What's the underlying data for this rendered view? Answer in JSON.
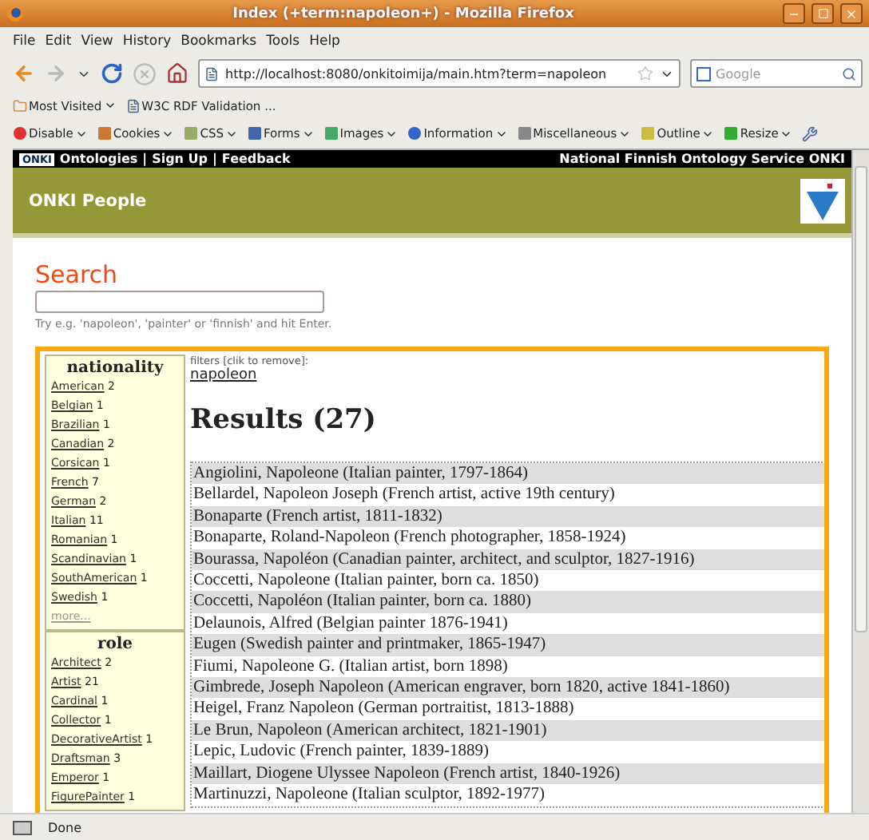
{
  "window": {
    "title": "Index (+term:napoleon+) - Mozilla Firefox"
  },
  "menu": [
    "File",
    "Edit",
    "View",
    "History",
    "Bookmarks",
    "Tools",
    "Help"
  ],
  "nav": {
    "url": "http://localhost:8080/onkitoimija/main.htm?term=napoleon",
    "search_placeholder": "Google"
  },
  "bookmarks": [
    "Most Visited",
    "W3C RDF Validation ..."
  ],
  "dev_toolbar": [
    {
      "label": "Disable",
      "kind": "disable"
    },
    {
      "label": "Cookies",
      "kind": "cookies"
    },
    {
      "label": "CSS",
      "kind": "css"
    },
    {
      "label": "Forms",
      "kind": "forms"
    },
    {
      "label": "Images",
      "kind": "images"
    },
    {
      "label": "Information",
      "kind": "information"
    },
    {
      "label": "Miscellaneous",
      "kind": "misc"
    },
    {
      "label": "Outline",
      "kind": "outline"
    },
    {
      "label": "Resize",
      "kind": "resize"
    }
  ],
  "site_bar": {
    "logo": "ONKI",
    "links": [
      "Ontologies",
      "Sign Up",
      "Feedback"
    ],
    "separator": "|",
    "service": "National Finnish Ontology Service ONKI"
  },
  "header": {
    "title": "ONKI People"
  },
  "search": {
    "heading": "Search",
    "hint": "Try e.g. 'napoleon', 'painter' or 'finnish' and hit Enter."
  },
  "facets": [
    {
      "title": "nationality",
      "more": "more...",
      "items": [
        {
          "label": "American",
          "count": "2"
        },
        {
          "label": "Belgian",
          "count": "1"
        },
        {
          "label": "Brazilian",
          "count": "1"
        },
        {
          "label": "Canadian",
          "count": "2"
        },
        {
          "label": "Corsican",
          "count": "1"
        },
        {
          "label": "French",
          "count": "7"
        },
        {
          "label": "German",
          "count": "2"
        },
        {
          "label": "Italian",
          "count": "11"
        },
        {
          "label": "Romanian",
          "count": "1"
        },
        {
          "label": "Scandinavian",
          "count": "1"
        },
        {
          "label": "SouthAmerican",
          "count": "1"
        },
        {
          "label": "Swedish",
          "count": "1"
        }
      ]
    },
    {
      "title": "role",
      "items": [
        {
          "label": "Architect",
          "count": "2"
        },
        {
          "label": "Artist",
          "count": "21"
        },
        {
          "label": "Cardinal",
          "count": "1"
        },
        {
          "label": "Collector",
          "count": "1"
        },
        {
          "label": "DecorativeArtist",
          "count": "1"
        },
        {
          "label": "Draftsman",
          "count": "3"
        },
        {
          "label": "Emperor",
          "count": "1"
        },
        {
          "label": "FigurePainter",
          "count": "1"
        }
      ]
    }
  ],
  "filters": {
    "label": "filters [clik to remove]:",
    "items": [
      "napoleon"
    ]
  },
  "results": {
    "heading": "Results (27)",
    "rows": [
      "Angiolini, Napoleone (Italian painter, 1797-1864)",
      "Bellardel, Napoleon Joseph (French artist, active 19th century)",
      "Bonaparte (French artist, 1811-1832)",
      "Bonaparte, Roland-Napoleon (French photographer, 1858-1924)",
      "Bourassa, Napoléon (Canadian painter, architect, and sculptor, 1827-1916)",
      "Coccetti, Napoleone (Italian painter, born ca. 1850)",
      "Coccetti, Napoléon (Italian painter, born ca. 1880)",
      "Delaunois, Alfred (Belgian painter 1876-1941)",
      "Eugen (Swedish painter and printmaker, 1865-1947)",
      "Fiumi, Napoleone G. (Italian artist, born 1898)",
      "Gimbrede, Joseph Napoleon (American engraver, born 1820, active 1841-1860)",
      "Heigel, Franz Napoleon (German portraitist, 1813-1888)",
      "Le Brun, Napoleon (American architect, 1821-1901)",
      "Lepic, Ludovic (French painter, 1839-1889)",
      "Maillart, Diogene Ulyssee Napoleon (French artist, 1840-1926)",
      "Martinuzzi, Napoleone (Italian sculptor, 1892-1977)"
    ]
  },
  "status": {
    "text": "Done"
  }
}
